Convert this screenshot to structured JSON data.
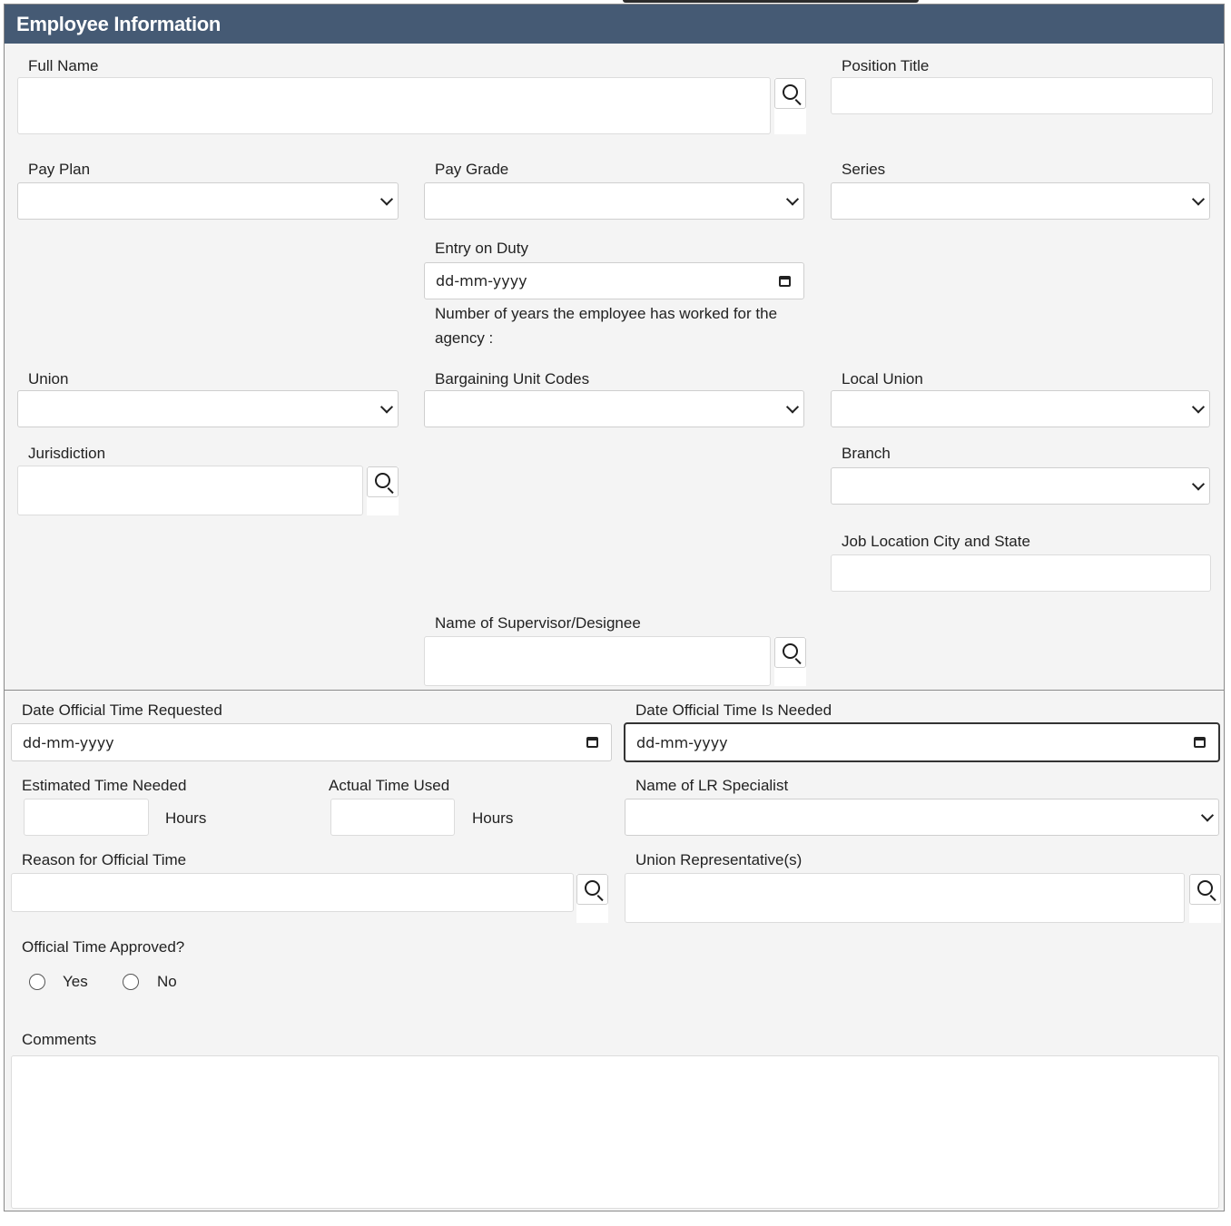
{
  "header": {
    "title": "Employee Information"
  },
  "fields": {
    "full_name": "Full Name",
    "position_title": "Position Title",
    "pay_plan": "Pay Plan",
    "pay_grade": "Pay Grade",
    "series": "Series",
    "entry_on_duty": "Entry on Duty",
    "entry_on_duty_value": "dd-mm-yyyy",
    "years_note": "Number of years the employee has worked for the agency :",
    "union": "Union",
    "bargaining_unit_codes": "Bargaining Unit Codes",
    "local_union": "Local Union",
    "jurisdiction": "Jurisdiction",
    "branch": "Branch",
    "job_location": "Job Location City and State",
    "supervisor": "Name of Supervisor/Designee",
    "date_requested": "Date Official Time Requested",
    "date_requested_value": "dd-mm-yyyy",
    "date_needed": "Date Official Time Is Needed",
    "date_needed_value": "dd-mm-yyyy",
    "estimated_time": "Estimated Time Needed",
    "actual_time": "Actual Time Used",
    "hours_unit_1": "Hours",
    "hours_unit_2": "Hours",
    "lr_specialist": "Name of LR Specialist",
    "reason": "Reason for Official Time",
    "union_reps": "Union Representative(s)",
    "approved": "Official Time Approved?",
    "approved_yes": "Yes",
    "approved_no": "No",
    "comments": "Comments"
  },
  "icons": {
    "search": "search-icon",
    "dropdown": "chevron-down-icon",
    "calendar": "calendar-icon"
  },
  "colors": {
    "header_bg": "#455a74",
    "panel_bg": "#f4f4f4"
  }
}
